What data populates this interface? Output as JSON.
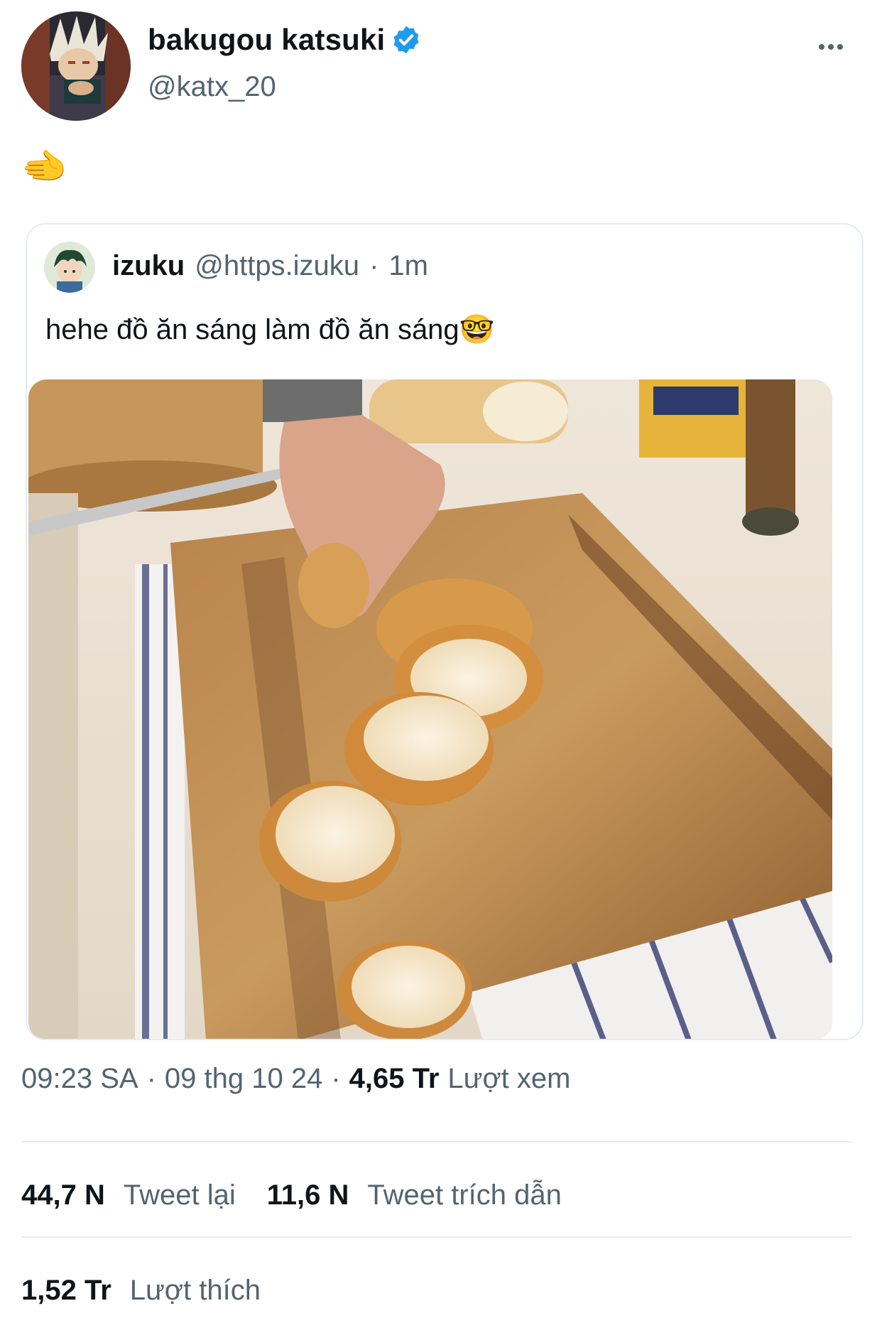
{
  "author": {
    "display_name": "bakugou katsuki",
    "handle": "@katx_20",
    "verified": true,
    "avatar_icon": "bakugou-avatar"
  },
  "tweet": {
    "text": "🫲"
  },
  "quoted_tweet": {
    "display_name": "izuku",
    "handle": "@https.izuku",
    "separator": "·",
    "time": "1m",
    "text": "hehe đồ ăn sáng làm đồ ăn sáng🤓",
    "avatar_icon": "izuku-avatar",
    "media_description_icon": "bread-cutting-board-photo"
  },
  "meta": {
    "time": "09:23 SA",
    "separator": "·",
    "date": "09 thg 10 24",
    "views_count": "4,65 Tr",
    "views_label": "Lượt xem"
  },
  "stats": {
    "retweets_count": "44,7 N",
    "retweets_label": "Tweet lại",
    "quotes_count": "11,6 N",
    "quotes_label": "Tweet trích dẫn",
    "likes_count": "1,52 Tr",
    "likes_label": "Lượt thích"
  },
  "colors": {
    "verified_blue": "#1d9bf0",
    "secondary_text": "#536471",
    "divider": "#e6ecf0"
  }
}
